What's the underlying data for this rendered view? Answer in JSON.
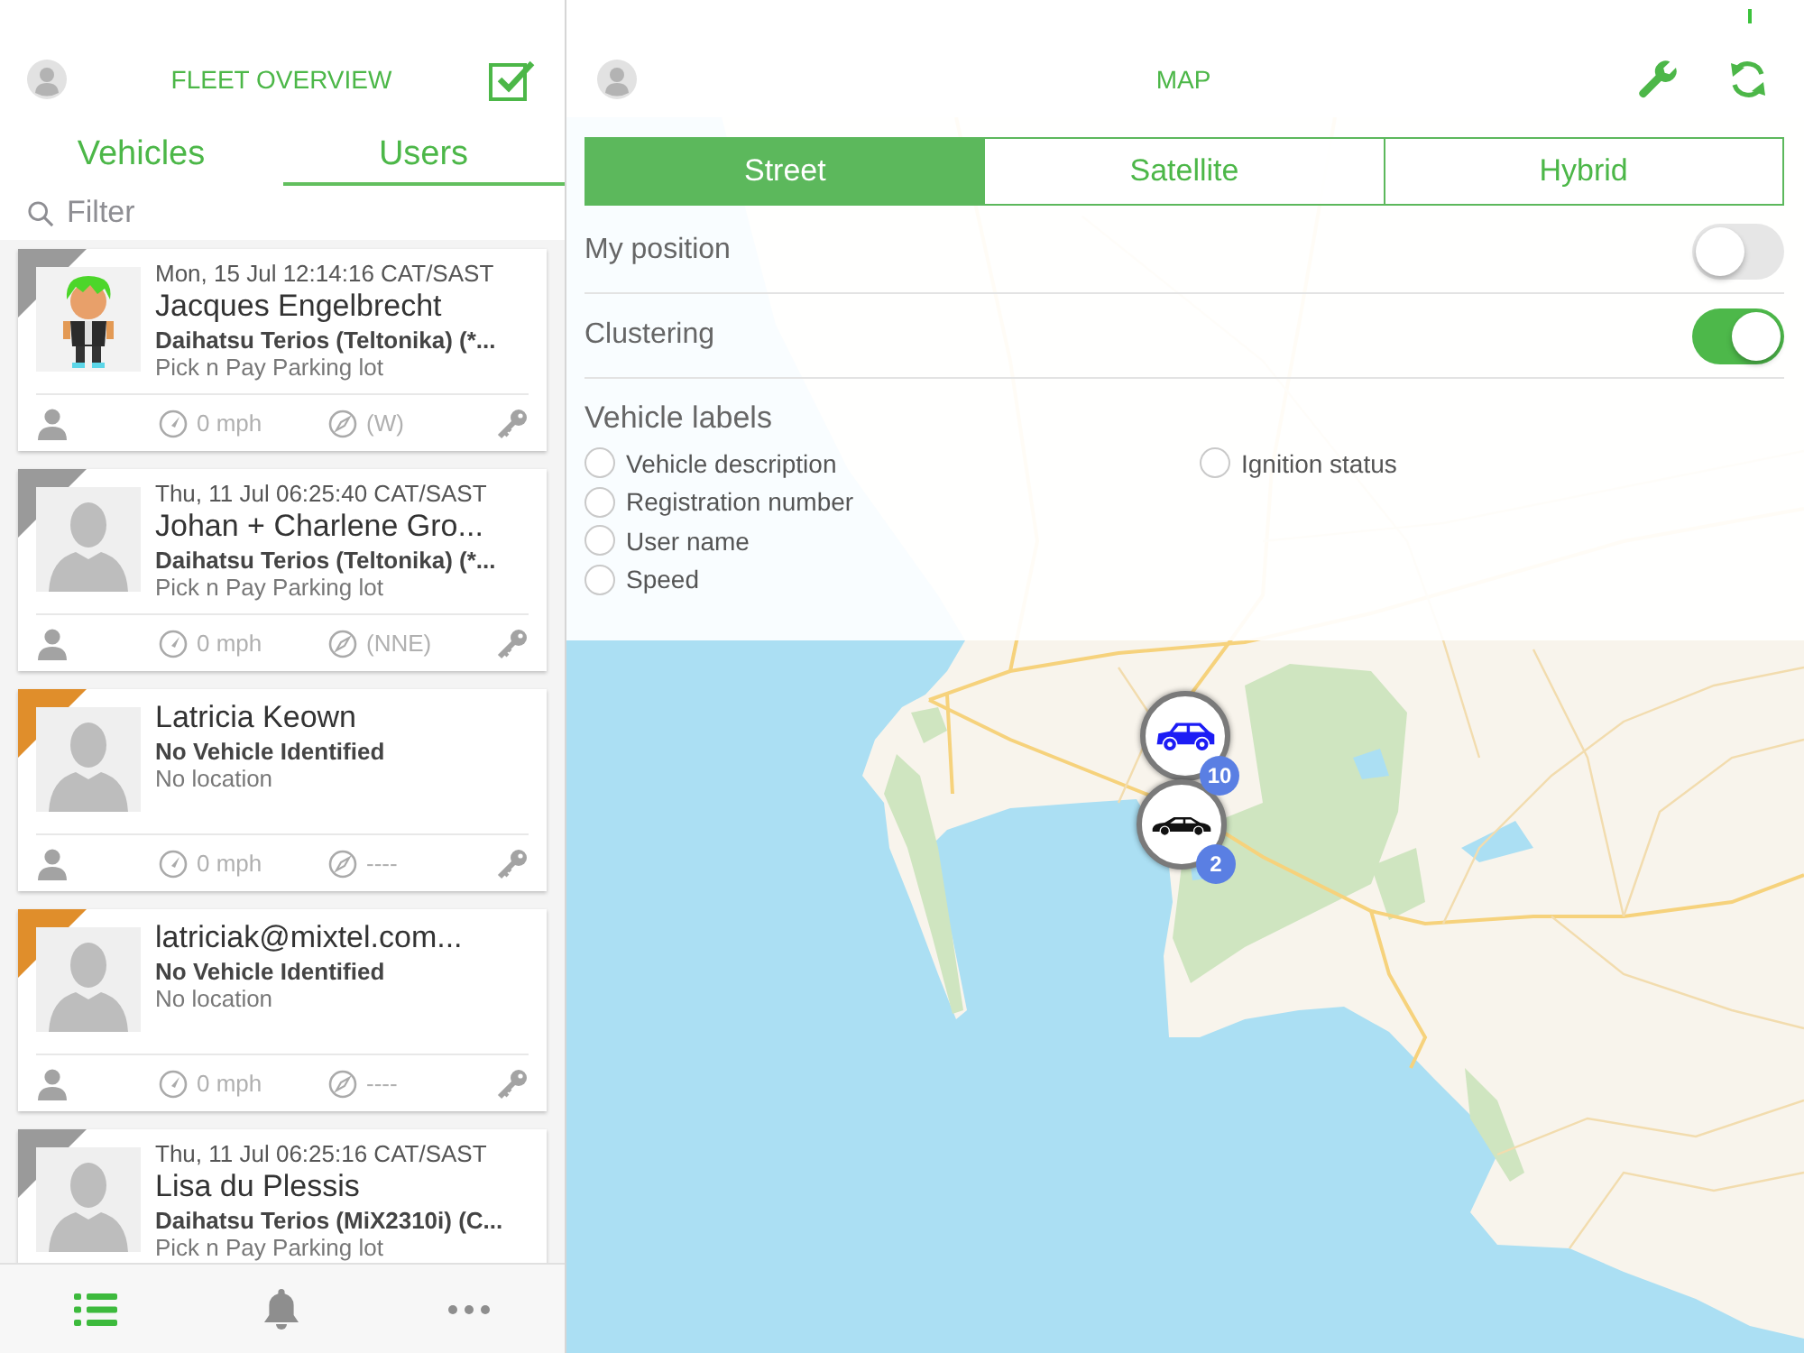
{
  "fleet_panel": {
    "title": "FLEET OVERVIEW",
    "tabs": [
      {
        "label": "Vehicles",
        "selected": false
      },
      {
        "label": "Users",
        "selected": true
      }
    ],
    "filter": {
      "placeholder": "Filter"
    },
    "cards": [
      {
        "kind": "custom_avatar",
        "color": "#9a9a9a",
        "date": "Mon, 15 Jul 12:14:16 CAT/SAST",
        "name": "Jacques Engelbrecht",
        "vehicle": "Daihatsu Terios (Teltonika) (*...",
        "location": "Pick n Pay Parking lot",
        "speed": "0 mph",
        "heading": "(W)"
      },
      {
        "kind": "default_avatar",
        "color": "#9a9a9a",
        "date": "Thu, 11 Jul 06:25:40 CAT/SAST",
        "name": "Johan + Charlene Gro...",
        "vehicle": "Daihatsu Terios (Teltonika) (*...",
        "location": "Pick n Pay Parking lot",
        "speed": "0 mph",
        "heading": "(NNE)"
      },
      {
        "kind": "default_avatar",
        "color": "#e08e2b",
        "name": "Latricia Keown",
        "vehicle": "No Vehicle Identified",
        "location": "No location",
        "speed": "0 mph",
        "heading": "----"
      },
      {
        "kind": "default_avatar",
        "color": "#e08e2b",
        "name": "latriciak@mixtel.com...",
        "vehicle": "No Vehicle Identified",
        "location": "No location",
        "speed": "0 mph",
        "heading": "----"
      },
      {
        "kind": "default_avatar",
        "color": "#9a9a9a",
        "date": "Thu, 11 Jul 06:25:16 CAT/SAST",
        "name": "Lisa du Plessis",
        "vehicle": "Daihatsu Terios (MiX2310i) (C...",
        "location": "Pick n Pay Parking lot"
      }
    ],
    "bottom_tabs": [
      {
        "kind": "list",
        "selected": true
      },
      {
        "kind": "bell",
        "selected": false
      },
      {
        "kind": "more",
        "selected": false
      }
    ]
  },
  "map_panel": {
    "title": "MAP",
    "map_types": [
      {
        "label": "Street",
        "selected": true
      },
      {
        "label": "Satellite",
        "selected": false
      },
      {
        "label": "Hybrid",
        "selected": false
      }
    ],
    "settings": [
      {
        "label": "My position",
        "on": false
      },
      {
        "label": "Clustering",
        "on": true
      }
    ],
    "vehicle_labels": {
      "heading": "Vehicle labels",
      "options": [
        {
          "label": "Vehicle description",
          "checked": false
        },
        {
          "label": "Registration number",
          "checked": false
        },
        {
          "label": "User name",
          "checked": false
        },
        {
          "label": "Speed",
          "checked": false
        },
        {
          "label": "Ignition status",
          "checked": false
        }
      ]
    },
    "clusters": [
      {
        "kind": "suv",
        "count": "10"
      },
      {
        "kind": "sedan",
        "count": "2"
      }
    ]
  }
}
